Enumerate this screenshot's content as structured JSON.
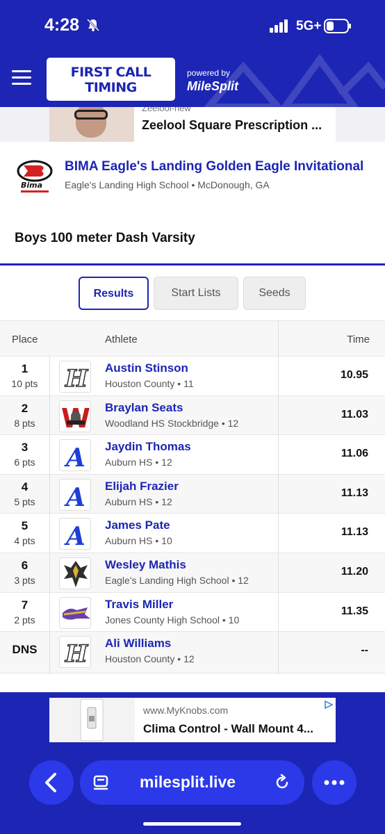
{
  "status": {
    "time": "4:28",
    "network": "5G+"
  },
  "header": {
    "logo_line1": "FIRST CALL",
    "logo_line2": "TIMING",
    "powered_by": "powered by",
    "brand": "MileSplit"
  },
  "ad_top": {
    "small": "Zeelool-new",
    "title": "Zeelool Square Prescription ..."
  },
  "meet": {
    "title": "BIMA Eagle's Landing Golden Eagle Invitational",
    "location": "Eagle's Landing High School • McDonough, GA"
  },
  "event": {
    "title": "Boys 100 meter Dash Varsity"
  },
  "tabs": [
    "Results",
    "Start Lists",
    "Seeds"
  ],
  "table": {
    "headers": {
      "place": "Place",
      "athlete": "Athlete",
      "time": "Time"
    },
    "rows": [
      {
        "place": "1",
        "pts": "10 pts",
        "name": "Austin Stinson",
        "team": "Houston County • 11",
        "time": "10.95"
      },
      {
        "place": "2",
        "pts": "8 pts",
        "name": "Braylan Seats",
        "team": "Woodland HS Stockbridge • 12",
        "time": "11.03"
      },
      {
        "place": "3",
        "pts": "6 pts",
        "name": "Jaydin Thomas",
        "team": "Auburn HS • 12",
        "time": "11.06"
      },
      {
        "place": "4",
        "pts": "5 pts",
        "name": "Elijah Frazier",
        "team": "Auburn HS • 12",
        "time": "11.13"
      },
      {
        "place": "5",
        "pts": "4 pts",
        "name": "James Pate",
        "team": "Auburn HS • 10",
        "time": "11.13"
      },
      {
        "place": "6",
        "pts": "3 pts",
        "name": "Wesley Mathis",
        "team": "Eagle's Landing High School • 12",
        "time": "11.20"
      },
      {
        "place": "7",
        "pts": "2 pts",
        "name": "Travis Miller",
        "team": "Jones County High School • 10",
        "time": "11.35"
      },
      {
        "place": "DNS",
        "pts": "",
        "name": "Ali Williams",
        "team": "Houston County • 12",
        "time": "--"
      }
    ]
  },
  "ad_bottom": {
    "small": "www.MyKnobs.com",
    "title": "Clima Control - Wall Mount 4..."
  },
  "browser": {
    "url": "milesplit.live"
  },
  "colors": {
    "primary": "#1d25b4",
    "button": "#2b39e8"
  }
}
